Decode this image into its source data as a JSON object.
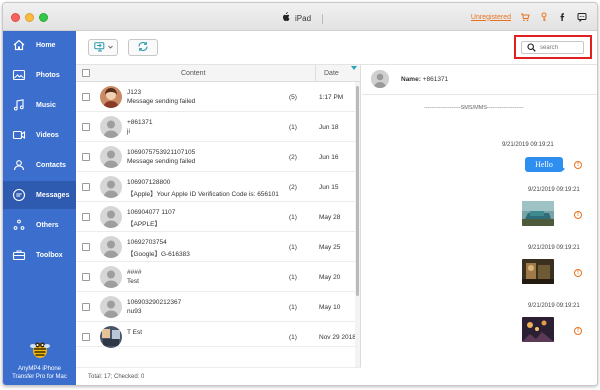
{
  "titlebar": {
    "device_name": "iPad",
    "unregistered_label": "Unregistered",
    "icons": [
      "cart-icon",
      "key-icon",
      "facebook-icon",
      "chat-icon"
    ]
  },
  "sidebar": {
    "items": [
      {
        "label": "Home",
        "icon": "home-icon",
        "active": false
      },
      {
        "label": "Photos",
        "icon": "photos-icon",
        "active": false
      },
      {
        "label": "Music",
        "icon": "music-icon",
        "active": false
      },
      {
        "label": "Videos",
        "icon": "videos-icon",
        "active": false
      },
      {
        "label": "Contacts",
        "icon": "contacts-icon",
        "active": false
      },
      {
        "label": "Messages",
        "icon": "messages-icon",
        "active": true
      },
      {
        "label": "Others",
        "icon": "others-icon",
        "active": false
      },
      {
        "label": "Toolbox",
        "icon": "toolbox-icon",
        "active": false
      }
    ],
    "brand": "AnyMP4 iPhone Transfer Pro for Mac"
  },
  "search": {
    "placeholder": "search"
  },
  "list": {
    "headers": {
      "content": "Content",
      "date": "Date"
    },
    "rows": [
      {
        "title": "J123",
        "sub": "Message sending failed",
        "count": "(5)",
        "date": "1:17 PM",
        "avatar": "photo"
      },
      {
        "title": "+861371",
        "sub": "ji",
        "count": "(1)",
        "date": "Jun 18",
        "avatar": "default"
      },
      {
        "title": "1069075753921107105",
        "sub": "Message sending failed",
        "count": "(2)",
        "date": "Jun 16",
        "avatar": "default"
      },
      {
        "title": "106907128800",
        "sub": "【Apple】Your Apple ID Verification Code is: 656101",
        "count": "(2)",
        "date": "Jun 15",
        "avatar": "default"
      },
      {
        "title": "106904077 1107",
        "sub": "【APPLE】",
        "count": "(1)",
        "date": "May 28",
        "avatar": "default"
      },
      {
        "title": "10692703754",
        "sub": "【Google】G-616383",
        "count": "(1)",
        "date": "May 25",
        "avatar": "default"
      },
      {
        "title": "####",
        "sub": "Test",
        "count": "(1)",
        "date": "May 20",
        "avatar": "default"
      },
      {
        "title": "106903290212367",
        "sub": "nu93",
        "count": "(1)",
        "date": "May 10",
        "avatar": "default"
      },
      {
        "title": "T Est",
        "sub": "",
        "count": "(1)",
        "date": "Nov 29 2018",
        "avatar": "photo2"
      }
    ],
    "footer": "Total: 17; Checked: 0"
  },
  "detail": {
    "name_label": "Name:",
    "name_value": "+861371",
    "separator": "--------------------SMS/MMS--------------------",
    "messages": [
      {
        "timestamp": "9/21/2019 09:19:21",
        "type": "text",
        "text": "Hello"
      },
      {
        "timestamp": "9/21/2019 09:19:21",
        "type": "image"
      },
      {
        "timestamp": "9/21/2019 09:19:21",
        "type": "image"
      },
      {
        "timestamp": "9/21/2019 09:19:21",
        "type": "image"
      }
    ]
  },
  "colors": {
    "sidebar": "#3c6fcd",
    "sidebar_active": "#2e5ab0",
    "accent_orange": "#e8731f",
    "bubble_blue": "#2f8ff0",
    "highlight_red": "#e02020"
  }
}
